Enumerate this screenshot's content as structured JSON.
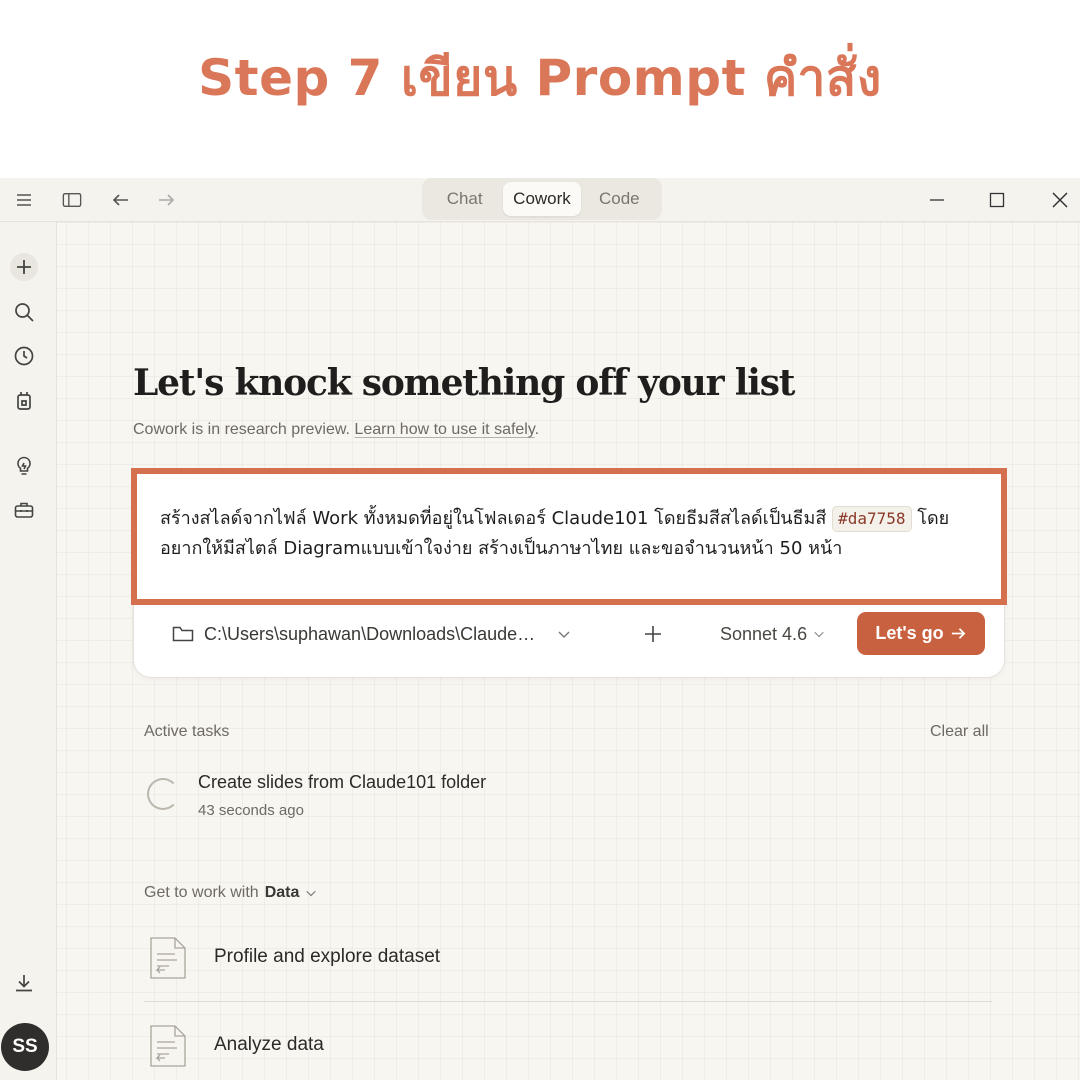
{
  "banner": {
    "title": "Step 7 เขียน Prompt คำสั่ง"
  },
  "colors": {
    "accent": "#da7758",
    "button": "#c8613f",
    "highlight_border": "#d5704e"
  },
  "titlebar": {
    "tabs": [
      {
        "label": "Chat",
        "active": false
      },
      {
        "label": "Cowork",
        "active": true
      },
      {
        "label": "Code",
        "active": false
      }
    ]
  },
  "sidebar": {
    "icons": [
      "plus-icon",
      "search-icon",
      "clock-icon",
      "scheduled-icon",
      "lightbulb-icon",
      "toolbox-icon",
      "download-icon"
    ],
    "avatar_initials": "SS"
  },
  "main": {
    "headline": "Let's knock something off your list",
    "subline_prefix": "Cowork is in research preview. ",
    "subline_link": "Learn how to use it safely",
    "subline_suffix": "."
  },
  "composer": {
    "prompt_part1": "สร้างสไลด์จากไฟล์ Work ทั้งหมดที่อยู่ในโฟลเดอร์ Claude101 โดยธีมสีสไลด์เป็นธีมสี ",
    "prompt_code": "#da7758",
    "prompt_part2": " โดยอยากให้มีสไตล์ Diagramแบบเข้าใจง่าย  สร้างเป็นภาษาไทย และขอจำนวนหน้า 50 หน้า",
    "folder_path": "C:\\Users\\suphawan\\Downloads\\Claude…",
    "model": "Sonnet 4.6",
    "go_label": "Let's go"
  },
  "active_tasks": {
    "label": "Active tasks",
    "clear_label": "Clear all",
    "items": [
      {
        "title": "Create slides from Claude101 folder",
        "time": "43 seconds ago"
      }
    ]
  },
  "work_with": {
    "prefix": "Get to work with ",
    "category": "Data",
    "suggestions": [
      {
        "label": "Profile and explore dataset"
      },
      {
        "label": "Analyze data"
      }
    ]
  }
}
